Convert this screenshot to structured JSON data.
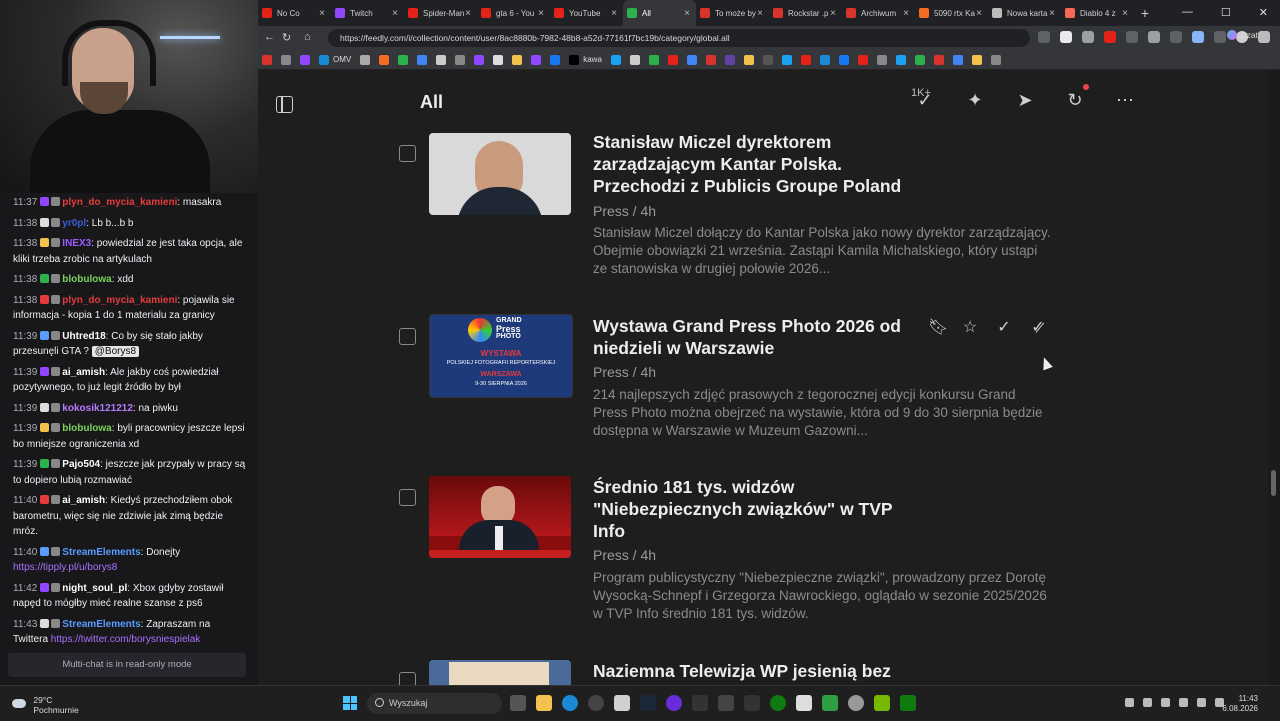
{
  "browser": {
    "tabs": [
      {
        "label": "No Co",
        "color": "#e62117",
        "active": false
      },
      {
        "label": "Twitch",
        "color": "#9146ff",
        "active": false
      },
      {
        "label": "Spider-Man",
        "color": "#e62117",
        "active": false
      },
      {
        "label": "gta 6 - You",
        "color": "#e62117",
        "active": false
      },
      {
        "label": "YouTube",
        "color": "#e62117",
        "active": false
      },
      {
        "label": "All",
        "color": "#2bb24c",
        "active": true
      },
      {
        "label": "To może by",
        "color": "#d8342c",
        "active": false
      },
      {
        "label": "Rockstar .p",
        "color": "#d8342c",
        "active": false
      },
      {
        "label": "Archiwum",
        "color": "#d8342c",
        "active": false
      },
      {
        "label": "5090 rtx Ka",
        "color": "#f36c21",
        "active": false
      },
      {
        "label": "Nowa karta",
        "color": "#bbbbbb",
        "active": false
      },
      {
        "label": "Diablo 4 z",
        "color": "#f96854",
        "active": false
      }
    ],
    "new_tab": "+",
    "url": "https://feedly.com/i/collection/content/user/8ac8880b-7982-48b8-a52d-77161f7bc19b/category/global.all",
    "czat_label": "Czat",
    "bookmarks": [
      "OMV",
      "kawa"
    ]
  },
  "chat": {
    "messages": [
      {
        "time": "11:37",
        "user": "plyn_do_mycia_kamieni",
        "user_color": "#e63b3b",
        "text": "masakra"
      },
      {
        "time": "11:38",
        "user": "yr0pl",
        "user_color": "#3a5bd6",
        "text": "Lb b...b b"
      },
      {
        "time": "11:38",
        "user": "INEX3",
        "user_color": "#9b5cff",
        "text": "powiedzial ze jest taka opcja, ale kliki trzeba zrobic na artykulach"
      },
      {
        "time": "11:38",
        "user": "blobulowa",
        "user_color": "#7ad35a",
        "text": "xdd"
      },
      {
        "time": "11:38",
        "user": "plyn_do_mycia_kamieni",
        "user_color": "#e63b3b",
        "text": "pojawila sie informacja - kopia 1 do 1 materialu za granicy"
      },
      {
        "time": "11:39",
        "user": "Uhtred18",
        "user_color": "#ffffff",
        "text": "Co by się stało jakby przesunęli GTA ?",
        "mention": "@Borys8"
      },
      {
        "time": "11:39",
        "user": "ai_amish",
        "user_color": "#ffffff",
        "text": "Ale jakby coś powiedział pozytywnego, to już legit źródło by był"
      },
      {
        "time": "11:39",
        "user": "kokosik121212",
        "user_color": "#b57bff",
        "text": "na piwku"
      },
      {
        "time": "11:39",
        "user": "blobulowa",
        "user_color": "#7ad35a",
        "text": "byli pracownicy jeszcze lepsi bo mniejsze ograniczenia xd"
      },
      {
        "time": "11:39",
        "user": "Pajo504",
        "user_color": "#ffffff",
        "text": "jeszcze jak przypały w pracy są to dopiero lubią rozmawiać"
      },
      {
        "time": "11:40",
        "user": "ai_amish",
        "user_color": "#ffffff",
        "text": "Kiedyś przechodziłem obok barometru, więc się nie zdziwie jak zimą będzie mróz."
      },
      {
        "time": "11:40",
        "user": "StreamElements",
        "user_color": "#5b9bff",
        "text": "Donejty",
        "link": "https://tipply.pl/u/borys8"
      },
      {
        "time": "11:42",
        "user": "night_soul_pl",
        "user_color": "#ffffff",
        "text": "Xbox gdyby zostawił napęd to mógłby mieć realne szanse z ps6"
      },
      {
        "time": "11:43",
        "user": "StreamElements",
        "user_color": "#5b9bff",
        "text": "Zapraszam na Twittera",
        "link": "https://twitter.com/borysniespielak"
      }
    ],
    "footer": "Multi-chat is in read-only mode"
  },
  "feedly": {
    "title": "All",
    "unread_count": "1K+",
    "articles": [
      {
        "title": "Stanisław Miczel dyrektorem zarządzającym Kantar Polska. Przechodzi z Publicis Groupe Poland",
        "meta": "Press / 4h",
        "summary": "Stanisław Miczel dołączy do Kantar Polska jako nowy dyrektor zarządzający. Obejmie obowiązki 21 września. Zastąpi Kamila Michalskiego, który ustąpi ze stanowiska w drugiej połowie 2026...",
        "thumb_color": "#d9d9d9"
      },
      {
        "title": "Wystawa Grand Press Photo 2026 od niedzieli w Warszawie",
        "meta": "Press / 4h",
        "summary": "214 najlepszych zdjęć prasowych z tegorocznej edycji konkursu Grand Press Photo można obejrzeć na wystawie, która od 9 do 30 sierpnia będzie dostępna w Warszawie w Muzeum Gazowni...",
        "thumb_color": "#1f3a7a",
        "thumb_lines": [
          "GRAND",
          "Press",
          "PHOTO",
          "WYSTAWA",
          "POLSKIEJ FOTOGRAFII REPORTERSKIEJ",
          "WARSZAWA",
          "9-30 SIERPNIA 2026"
        ]
      },
      {
        "title": "Średnio 181 tys. widzów \"Niebezpiecznych związków\" w TVP Info",
        "meta": "Press / 4h",
        "summary": "Program publicystyczny \"Niebezpieczne związki\", prowadzony przez Dorotę Wysocką-Schnepf i Grzegorza Nawrockiego, oglądało w sezonie 2025/2026 w TVP Info średnio 181 tys. widzów.",
        "thumb_color": "#8a0d0d"
      },
      {
        "title": "Naziemna Telewizja WP jesienią bez",
        "meta": "",
        "summary": "",
        "thumb_color": "#4a6a9a"
      }
    ]
  },
  "taskbar": {
    "temperature": "29°C",
    "weather": "Pochmurnie",
    "search_placeholder": "Wyszukaj",
    "time": "11:43",
    "date": "6.08.2026"
  }
}
